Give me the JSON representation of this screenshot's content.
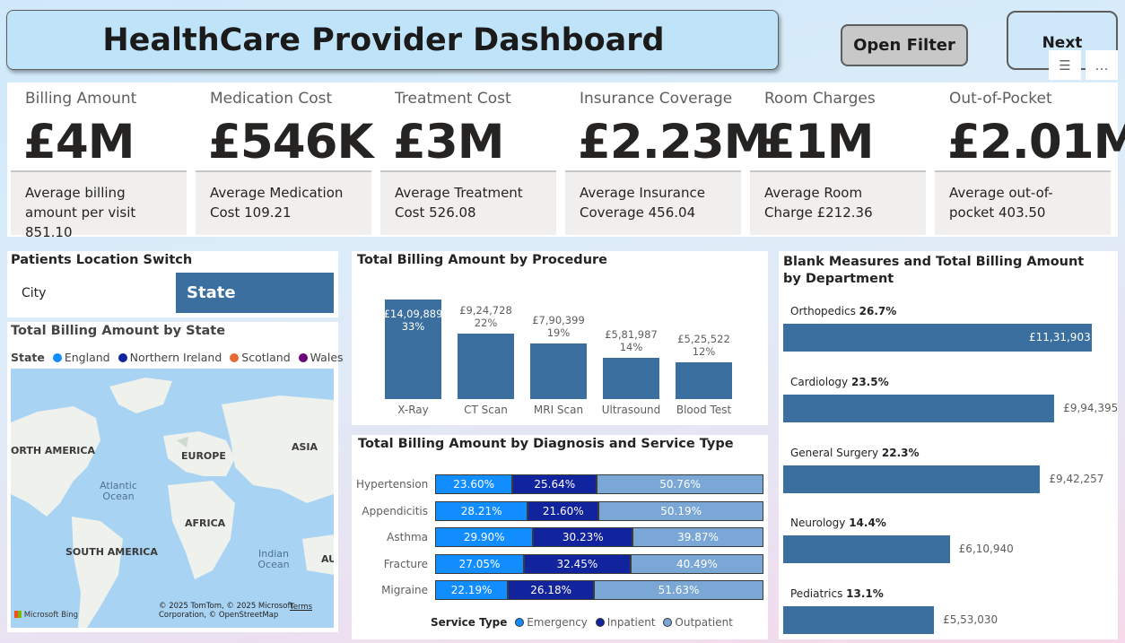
{
  "header": {
    "title": "HealthCare Provider Dashboard",
    "open_filter_label": "Open Filter",
    "next_label": "Next",
    "filter_icon_glyph": "☰",
    "more_icon_glyph": "…"
  },
  "kpis": [
    {
      "label": "Billing Amount",
      "value": "£4M",
      "sub": "Average billing amount per visit 851.10"
    },
    {
      "label": "Medication Cost",
      "value": "£546K",
      "sub": "Average Medication Cost 109.21"
    },
    {
      "label": "Treatment Cost",
      "value": "£3M",
      "sub": "Average Treatment Cost 526.08"
    },
    {
      "label": "Insurance Coverage",
      "value": "£2.23M",
      "sub": "Average Insurance Coverage 456.04"
    },
    {
      "label": "Room Charges",
      "value": "£1M",
      "sub": "Average Room Charge £212.36"
    },
    {
      "label": "Out-of-Pocket",
      "value": "£2.01M",
      "sub": "Average out-of-pocket 403.50"
    }
  ],
  "location_switch": {
    "title": "Patients Location Switch",
    "option_city": "City",
    "option_state": "State",
    "selected": "State"
  },
  "map_panel": {
    "title": "Total Billing Amount by State",
    "legend_title": "State",
    "legend": [
      {
        "name": "England",
        "color": "#118dff"
      },
      {
        "name": "Northern Ireland",
        "color": "#12239e"
      },
      {
        "name": "Scotland",
        "color": "#e66c37"
      },
      {
        "name": "Wales",
        "color": "#6b007b"
      }
    ],
    "labels": {
      "north_america": "ORTH AMERICA",
      "europe": "EUROPE",
      "asia": "ASIA",
      "africa": "AFRICA",
      "south_america": "SOUTH AMERICA",
      "au": "AU",
      "atlantic": "Atlantic Ocean",
      "indian": "Indian Ocean"
    },
    "attribution": "© 2025 TomTom, © 2025 Microsoft Corporation, © OpenStreetMap",
    "terms": "Terms",
    "bing": "Microsoft Bing"
  },
  "chart_data": [
    {
      "type": "bar",
      "title": "Total Billing Amount by Procedure",
      "categories": [
        "X-Ray",
        "CT Scan",
        "MRI Scan",
        "Ultrasound",
        "Blood Test"
      ],
      "values": [
        1409889,
        924728,
        790399,
        581987,
        525522
      ],
      "value_labels": [
        "£14,09,889",
        "£9,24,728",
        "£7,90,399",
        "£5,81,987",
        "£5,25,522"
      ],
      "percent_labels": [
        "33%",
        "22%",
        "19%",
        "14%",
        "12%"
      ],
      "color": "#3a6f9f"
    },
    {
      "type": "bar",
      "title": "Total Billing Amount by Diagnosis and Service Type",
      "stacked": "100%",
      "orientation": "horizontal",
      "categories": [
        "Hypertension",
        "Appendicitis",
        "Asthma",
        "Fracture",
        "Migraine"
      ],
      "series": [
        {
          "name": "Emergency",
          "color": "#118dff",
          "values": [
            23.6,
            28.21,
            29.9,
            27.05,
            22.19
          ],
          "labels": [
            "23.60%",
            "28.21%",
            "29.90%",
            "27.05%",
            "22.19%"
          ]
        },
        {
          "name": "Inpatient",
          "color": "#12239e",
          "values": [
            25.64,
            21.6,
            30.23,
            32.45,
            26.18
          ],
          "labels": [
            "25.64%",
            "21.60%",
            "30.23%",
            "32.45%",
            "26.18%"
          ]
        },
        {
          "name": "Outpatient",
          "color": "#7aa7d6",
          "values": [
            50.76,
            50.19,
            39.87,
            40.49,
            51.63
          ],
          "labels": [
            "50.76%",
            "50.19%",
            "39.87%",
            "40.49%",
            "51.63%"
          ]
        }
      ],
      "legend_title": "Service Type",
      "legend_position": "bottom"
    },
    {
      "type": "bar",
      "orientation": "horizontal",
      "title": "Blank Measures and Total Billing Amount by Department",
      "categories": [
        "Orthopedics",
        "Cardiology",
        "General Surgery",
        "Neurology",
        "Pediatrics"
      ],
      "percent_labels": [
        "26.7%",
        "23.5%",
        "22.3%",
        "14.4%",
        "13.1%"
      ],
      "values": [
        1131903,
        994395,
        942257,
        610940,
        553030
      ],
      "value_labels": [
        "£11,31,903",
        "£9,94,395",
        "£9,42,257",
        "£6,10,940",
        "£5,53,030"
      ],
      "color": "#3a6f9f"
    }
  ]
}
